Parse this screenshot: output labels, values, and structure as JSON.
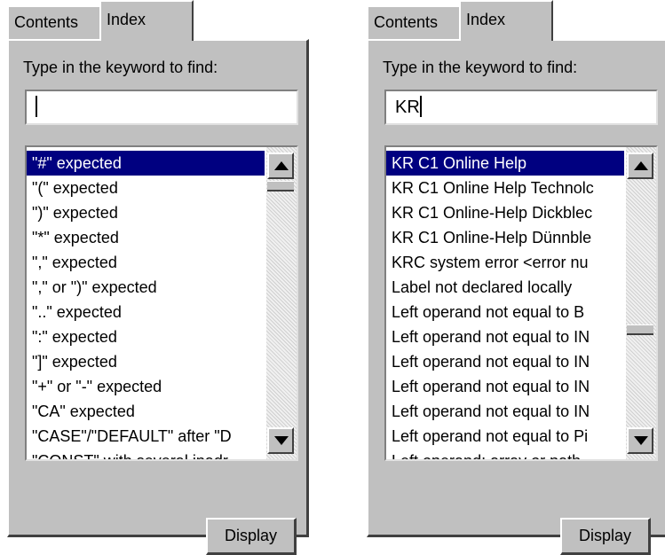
{
  "panels": [
    {
      "tabs": {
        "contents_label": "Contents",
        "index_label": "Index",
        "active": "Index"
      },
      "prompt": "Type in the keyword to find:",
      "search_value": "",
      "list": [
        "\"#\" expected",
        "\"(\" expected",
        "\")\" expected",
        "\"*\" expected",
        "\",\" expected",
        "\",\" or \")\" expected",
        "\"..\" expected",
        "\":\" expected",
        "\"]\" expected",
        "\"+\" or \"-\" expected",
        "\"CA\" expected",
        "\"CASE\"/\"DEFAULT\" after \"D",
        "\"CONST\" with several inadr"
      ],
      "selected_index": 0,
      "display_label": "Display"
    },
    {
      "tabs": {
        "contents_label": "Contents",
        "index_label": "Index",
        "active": "Index"
      },
      "prompt": "Type in the keyword to find:",
      "search_value": "KR",
      "list": [
        "KR C1 Online Help",
        "KR C1 Online Help Technolc",
        "KR C1 Online-Help Dickblec",
        "KR C1 Online-Help Dünnble",
        "KRC system error <error nu",
        "Label not declared locally",
        "Left operand not equal to B",
        "Left operand not equal to IN",
        "Left operand not equal to IN",
        "Left operand not equal to IN",
        "Left operand not equal to IN",
        "Left operand not equal to Pi",
        "Left operand: array or path"
      ],
      "selected_index": 0,
      "display_label": "Display"
    }
  ],
  "icons": {
    "scroll_up": "triangle-up-icon",
    "scroll_down": "triangle-down-icon"
  },
  "colors": {
    "face": "#c0c0c0",
    "selection": "#000080",
    "window": "#ffffff"
  }
}
